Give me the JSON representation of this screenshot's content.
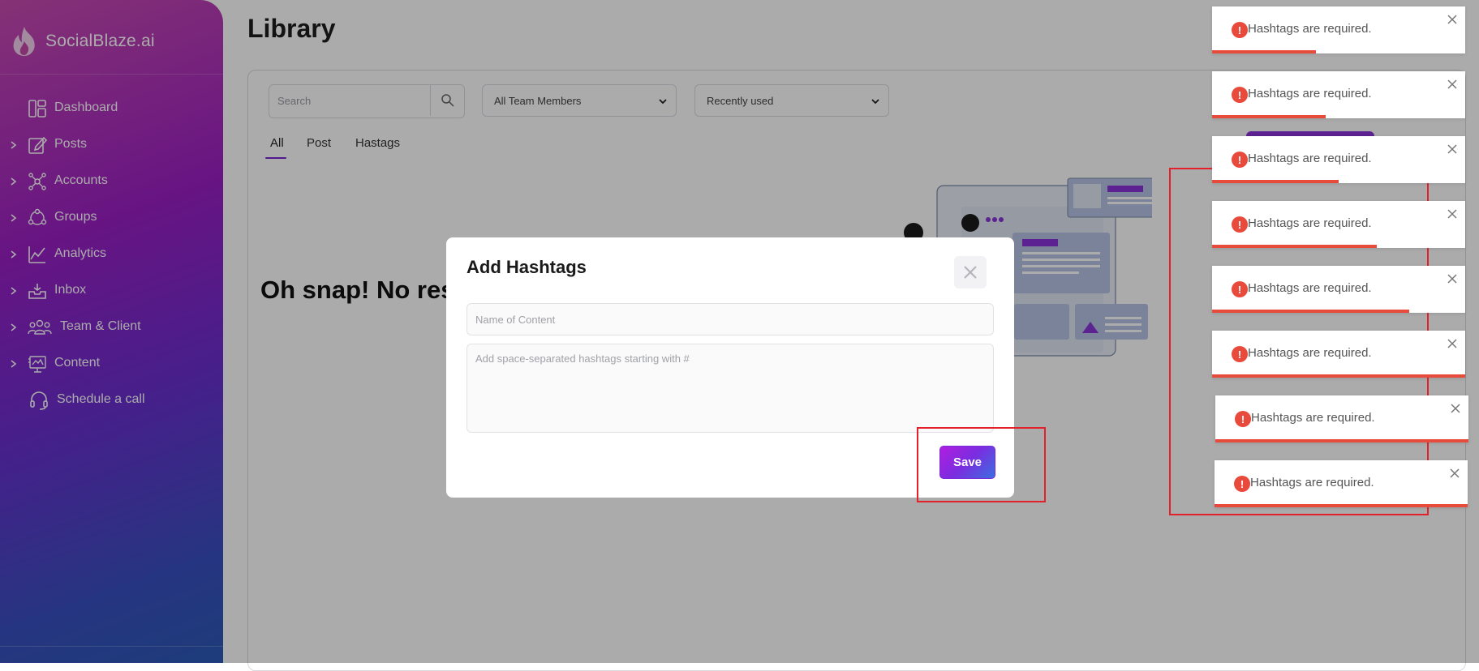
{
  "brand": {
    "name": "SocialBlaze.ai"
  },
  "sidebar": {
    "items": [
      {
        "label": "Dashboard",
        "icon": "dashboard-icon",
        "expandable": false
      },
      {
        "label": "Posts",
        "icon": "edit-icon",
        "expandable": true
      },
      {
        "label": "Accounts",
        "icon": "network-icon",
        "expandable": true
      },
      {
        "label": "Groups",
        "icon": "groups-icon",
        "expandable": true
      },
      {
        "label": "Analytics",
        "icon": "analytics-icon",
        "expandable": true
      },
      {
        "label": "Inbox",
        "icon": "inbox-icon",
        "expandable": true
      },
      {
        "label": "Team & Client",
        "icon": "team-icon",
        "expandable": true
      },
      {
        "label": "Content",
        "icon": "content-icon",
        "expandable": true
      },
      {
        "label": "Schedule a call",
        "icon": "headset-icon",
        "expandable": false
      }
    ]
  },
  "page": {
    "title": "Library"
  },
  "filters": {
    "search_placeholder": "Search",
    "team_members": "All Team Members",
    "sort": "Recently used"
  },
  "tabs": [
    {
      "label": "All",
      "active": true
    },
    {
      "label": "Post",
      "active": false
    },
    {
      "label": "Hastags",
      "active": false
    }
  ],
  "empty_state": {
    "title": "Oh snap! No res"
  },
  "modal": {
    "title": "Add Hashtags",
    "name_placeholder": "Name of Content",
    "hashtags_placeholder": "Add space-separated hashtags starting with #",
    "save_label": "Save"
  },
  "toasts": [
    {
      "message": "Hashtags are required.",
      "progress": 0.41
    },
    {
      "message": "Hashtags are required.",
      "progress": 0.45
    },
    {
      "message": "Hashtags are required.",
      "progress": 0.5
    },
    {
      "message": "Hashtags are required.",
      "progress": 0.65
    },
    {
      "message": "Hashtags are required.",
      "progress": 0.78
    },
    {
      "message": "Hashtags are required.",
      "progress": 1.0
    },
    {
      "message": "Hashtags are required.",
      "progress": 1.0
    },
    {
      "message": "Hashtags are required.",
      "progress": 1.0
    }
  ],
  "colors": {
    "accent": "#7a24d9",
    "error": "#e84a3b",
    "highlight": "#e3212a"
  }
}
